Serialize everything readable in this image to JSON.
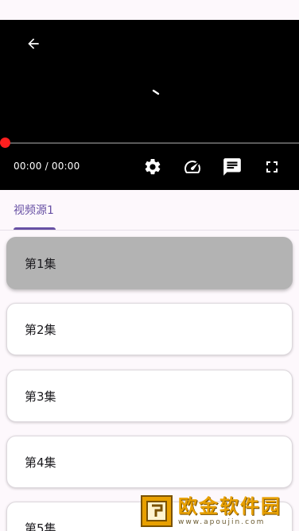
{
  "player": {
    "time_text": "00:00 / 00:00",
    "progress": 0,
    "controls": [
      "settings-icon",
      "speed-icon",
      "danmaku-icon",
      "fullscreen-icon"
    ]
  },
  "tabs": [
    {
      "label": "视频源1",
      "selected": true
    }
  ],
  "episodes": [
    {
      "label": "第1集",
      "selected": true
    },
    {
      "label": "第2集",
      "selected": false
    },
    {
      "label": "第3集",
      "selected": false
    },
    {
      "label": "第4集",
      "selected": false
    },
    {
      "label": "第5集",
      "selected": false
    }
  ],
  "watermark": {
    "main": "欧金软件园",
    "sub": "www.apoujin.com"
  },
  "colors": {
    "accent": "#6750a4",
    "progress_thumb": "#ff1f1f",
    "selected_episode": "#b3b3b3",
    "watermark": "#e8a000"
  }
}
